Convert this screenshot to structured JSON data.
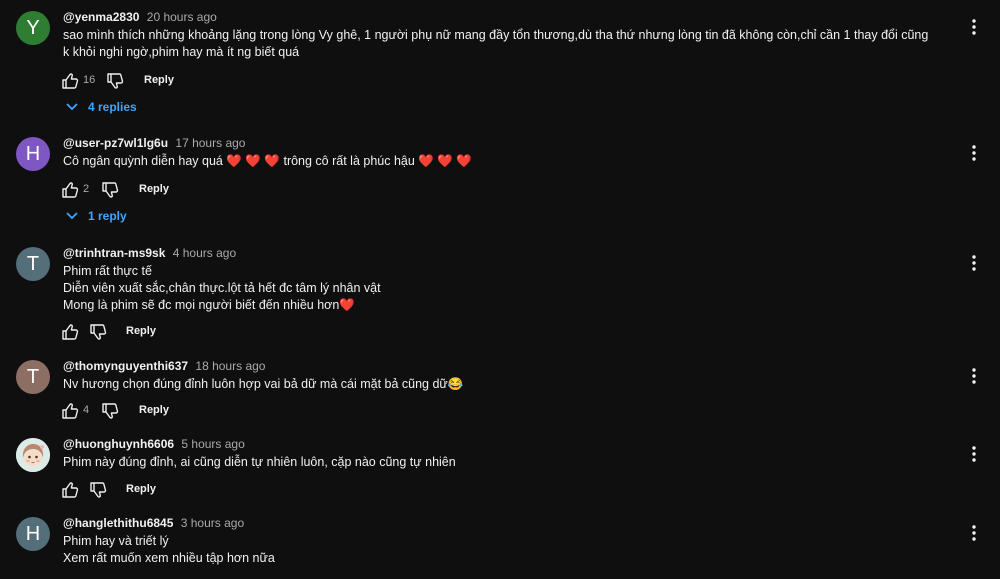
{
  "comments": [
    {
      "author": "@yenma2830",
      "time": "20 hours ago",
      "avatar_letter": "Y",
      "avatar_color": "#2e7d32",
      "lines": [
        "sao mình thích những khoảng lặng trong lòng Vy ghê, 1 người phụ nữ mang đầy tổn thương,dù tha thứ nhưng lòng tin đã không còn,chỉ cần 1 thay đổi cũng k khỏi nghi ngờ,phim hay mà ít ng biết quá"
      ],
      "likes": "16",
      "reply_label": "Reply",
      "replies_label": "4 replies"
    },
    {
      "author": "@user-pz7wl1lg6u",
      "time": "17 hours ago",
      "avatar_letter": "H",
      "avatar_color": "#7e57c2",
      "text_a": "Cô ngân quỳnh diễn hay quá",
      "hearts_a": "❤️ ❤️ ❤️",
      "text_b": "trông cô rất là phúc hậu",
      "hearts_b": "❤️ ❤️ ❤️",
      "likes": "2",
      "reply_label": "Reply",
      "replies_label": "1 reply"
    },
    {
      "author": "@trinhtran-ms9sk",
      "time": "4 hours ago",
      "avatar_letter": "T",
      "avatar_color": "#546e7a",
      "line1": "Phim rất thực tế",
      "line2": "Diễn viên xuất sắc,chân thực.lột tả hết đc tâm lý nhân vật",
      "line3": "Mong là phim sẽ đc mọi người biết đến nhiều hơn",
      "line3_emoji": "❤️",
      "reply_label": "Reply"
    },
    {
      "author": "@thomynguyenthi637",
      "time": "18 hours ago",
      "avatar_letter": "T",
      "avatar_color": "#8d6e63",
      "text": "Nv hương chọn đúng đỉnh luôn hợp vai bả dữ mà cái mặt bả cũng dữ",
      "emoji": "😂",
      "likes": "4",
      "reply_label": "Reply"
    },
    {
      "author": "@huonghuynh6606",
      "time": "5 hours ago",
      "text": "Phim này đúng đỉnh, ai cũng diễn tự nhiên luôn, cặp nào cũng tự nhiên",
      "reply_label": "Reply"
    },
    {
      "author": "@hanglethithu6845",
      "time": "3 hours ago",
      "avatar_letter": "H",
      "avatar_color": "#546e7a",
      "line1": "Phim hay và triết lý",
      "line2": "Xem rất muốn xem nhiều tập hơn nữa"
    }
  ]
}
